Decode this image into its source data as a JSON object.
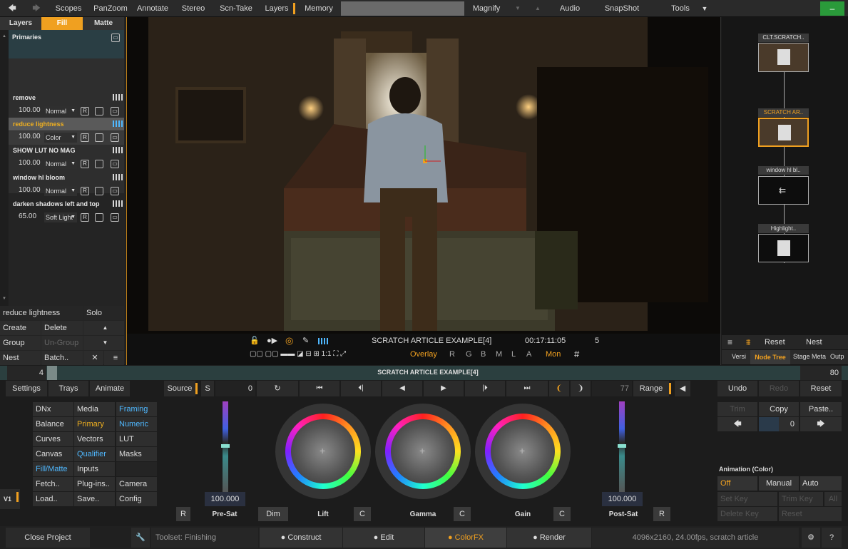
{
  "menu": {
    "back": "back",
    "fwd": "fwd",
    "items": [
      "Scopes",
      "PanZoom",
      "Annotate",
      "Stereo",
      "Scn-Take",
      "Layers",
      "Memory",
      "Magnify",
      "Audio",
      "SnapShot",
      "Tools"
    ]
  },
  "left": {
    "tabs": [
      "Layers",
      "Fill",
      "Matte"
    ],
    "primaries": "Primaries",
    "layers": [
      {
        "name": "remove",
        "value": "100.00",
        "mode": "Normal",
        "sel": false
      },
      {
        "name": "reduce lightness",
        "value": "100.00",
        "mode": "Color",
        "sel": true
      },
      {
        "name": "SHOW LUT NO MAG",
        "value": "100.00",
        "mode": "Normal",
        "sel": false
      },
      {
        "name": "window hl bloom",
        "value": "100.00",
        "mode": "Normal",
        "sel": false
      },
      {
        "name": "darken shadows left and top",
        "value": "65.00",
        "mode": "Soft Light",
        "sel": false
      }
    ],
    "r": "R",
    "current": "reduce lightness",
    "solo": "Solo",
    "create": "Create",
    "delete": "Delete",
    "group": "Group",
    "ungroup": "Un-Group",
    "nest": "Nest",
    "batch": "Batch..",
    "close": "✕",
    "menu": "≡",
    "up": "▲",
    "down": "▼"
  },
  "viewer": {
    "title": "SCRATCH ARTICLE EXAMPLE[4]",
    "timecode": "00:17:11:05",
    "frame": "5",
    "overlay": "Overlay",
    "channels": [
      "R",
      "G",
      "B",
      "M",
      "L",
      "A"
    ],
    "mon": "Mon"
  },
  "right": {
    "nodes": [
      "CLT.SCRATCH..",
      "SCRATCH AR..",
      "window hl bl..",
      "Highlight.."
    ],
    "reset": "Reset",
    "nest": "Nest",
    "tabs": [
      "Versi",
      "Node Tree",
      "Stage",
      "Meta",
      "Outp"
    ]
  },
  "timeline": {
    "start": "4",
    "title": "SCRATCH ARTICLE EXAMPLE[4]",
    "end": "80"
  },
  "toolbar": {
    "settings": "Settings",
    "trays": "Trays",
    "animate": "Animate",
    "source": "Source",
    "s": "S",
    "frame": "0",
    "right_frame": "77",
    "range": "Range",
    "undo": "Undo",
    "redo": "Redo",
    "reset": "Reset"
  },
  "grid": [
    [
      "DNx",
      "Media",
      "Framing"
    ],
    [
      "Balance",
      "Primary",
      "Numeric"
    ],
    [
      "Curves",
      "Vectors",
      "LUT"
    ],
    [
      "Canvas",
      "Qualifier",
      "Masks"
    ],
    [
      "Fill/Matte",
      "Inputs",
      ""
    ],
    [
      "Fetch..",
      "Plug-ins..",
      "Camera"
    ],
    [
      "Load..",
      "Save..",
      "Config"
    ]
  ],
  "v1": "V1",
  "wheels": {
    "presat_value": "100.000",
    "postsat_value": "100.000",
    "presat": "Pre-Sat",
    "lift": "Lift",
    "gamma": "Gamma",
    "gain": "Gain",
    "postsat": "Post-Sat",
    "dim": "Dim",
    "c": "C",
    "r": "R"
  },
  "edit": {
    "trim": "Trim",
    "copy": "Copy",
    "paste": "Paste..",
    "value": "0",
    "anim_title": "Animation (Color)",
    "off": "Off",
    "manual": "Manual",
    "auto": "Auto",
    "setkey": "Set Key",
    "trimkey": "Trim Key",
    "all": "All",
    "deletekey": "Delete Key",
    "reset": "Reset"
  },
  "bottom": {
    "close": "Close Project",
    "toolset": "Toolset: Finishing",
    "construct": "Construct",
    "edit": "Edit",
    "colorfx": "ColorFX",
    "render": "Render",
    "info": "4096x2160, 24.00fps, scratch article",
    "help": "?"
  },
  "colors": {
    "accent": "#f0a020",
    "active_text": "#f0b020",
    "blue_text": "#4fb8ff"
  }
}
